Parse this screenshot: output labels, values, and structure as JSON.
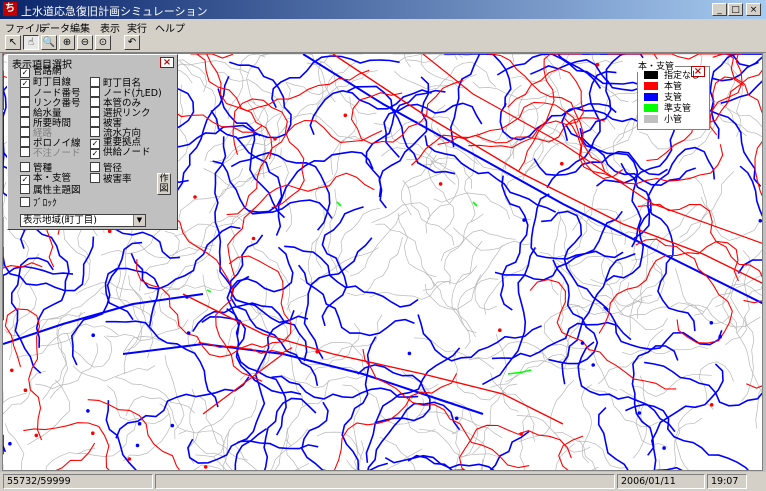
{
  "window": {
    "title": "上水道応急復旧計画シミュレーション",
    "app_icon_label": "ち",
    "minimize": "_",
    "maximize": "□",
    "close": "×"
  },
  "menu": [
    "ファイル",
    "データ編集",
    "表示",
    "実行",
    "ヘルプ"
  ],
  "toolbar": {
    "icons": [
      "pointer-icon",
      "pan-icon",
      "zoom-icon",
      "zoom-in-icon",
      "zoom-out-icon",
      "zoom-fit-icon",
      "undo-icon"
    ],
    "glyphs": [
      "↖",
      "☝",
      "🔍",
      "⊕",
      "⊖",
      "⊙",
      "↶"
    ]
  },
  "panel": {
    "title": "表示項目選択",
    "close": "×",
    "checks": [
      {
        "label": "管路網",
        "checked": true,
        "dim": false
      },
      {
        "label": "町丁目線",
        "checked": true,
        "dim": false
      },
      {
        "label": "町丁目名",
        "checked": false,
        "dim": false
      },
      {
        "label": "ノード番号",
        "checked": false,
        "dim": false
      },
      {
        "label": "ノード(九ED)",
        "checked": false,
        "dim": false
      },
      {
        "label": "リンク番号",
        "checked": false,
        "dim": false
      },
      {
        "label": "本管のみ",
        "checked": false,
        "dim": false
      },
      {
        "label": "給水量",
        "checked": false,
        "dim": false
      },
      {
        "label": "選択リンク",
        "checked": false,
        "dim": false
      },
      {
        "label": "所要時間",
        "checked": false,
        "dim": false
      },
      {
        "label": "被害",
        "checked": false,
        "dim": false
      },
      {
        "label": "経路",
        "checked": false,
        "dim": true
      },
      {
        "label": "流水方向",
        "checked": false,
        "dim": false
      },
      {
        "label": "ポロノイ線",
        "checked": false,
        "dim": false
      },
      {
        "label": "重要拠点",
        "checked": true,
        "dim": false
      },
      {
        "label": "不注ノード",
        "checked": false,
        "dim": true
      },
      {
        "label": "供給ノード",
        "checked": true,
        "dim": false
      },
      {
        "label": "管種",
        "checked": false,
        "dim": false
      },
      {
        "label": "管径",
        "checked": false,
        "dim": false
      },
      {
        "label": "本・支管",
        "checked": true,
        "dim": false
      },
      {
        "label": "被害率",
        "checked": false,
        "dim": false
      },
      {
        "label": "属性主題図",
        "checked": false,
        "dim": false
      },
      {
        "label": "ﾌﾞﾛｯｸ",
        "checked": false,
        "dim": false
      }
    ],
    "draw_button": "作図",
    "area_select": "表示地域(町丁目)"
  },
  "legend": {
    "title": "本・支管",
    "close": "×",
    "items": [
      {
        "label": "指定なし",
        "color": "#000000"
      },
      {
        "label": "本管",
        "color": "#ff0000"
      },
      {
        "label": "支管",
        "color": "#0000ff"
      },
      {
        "label": "準支管",
        "color": "#00ff00"
      },
      {
        "label": "小管",
        "color": "#c0c0c0"
      }
    ]
  },
  "status": {
    "count": "55732/59999",
    "date": "2006/01/11",
    "time": "19:07"
  },
  "colors": {
    "main_pipe": "#ff0000",
    "branch_pipe": "#0000ff",
    "sub_branch_pipe": "#00ff00",
    "small_pipe": "#c0c0c0"
  }
}
